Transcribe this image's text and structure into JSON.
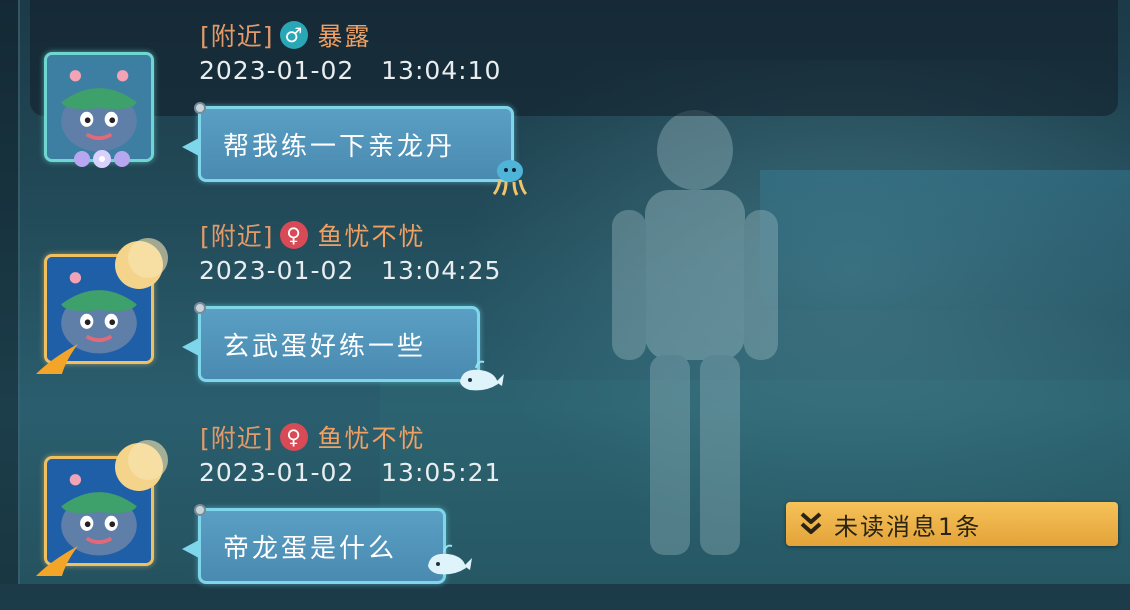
{
  "messages": [
    {
      "channel": "[附近]",
      "gender": "♂",
      "name": "暴露",
      "time": "2023-01-02   13:04:10",
      "text": "帮我练一下亲龙丹"
    },
    {
      "channel": "[附近]",
      "gender": "♀",
      "name": "鱼忧不忧",
      "time": "2023-01-02   13:04:25",
      "text": "玄武蛋好练一些"
    },
    {
      "channel": "[附近]",
      "gender": "♀",
      "name": "鱼忧不忧",
      "time": "2023-01-02   13:05:21",
      "text": "帝龙蛋是什么"
    }
  ],
  "unread": {
    "label": "未读消息1条",
    "icon": "double-chevron-down-icon"
  },
  "colors": {
    "channel": "#e39a6a",
    "name": "#f0a063",
    "bubble": "#4a8ab0",
    "bubble_border": "#7fd6ea",
    "male_badge": "#2aa7b6",
    "female_badge": "#d84a56",
    "unread_bg": "#e3a338"
  }
}
